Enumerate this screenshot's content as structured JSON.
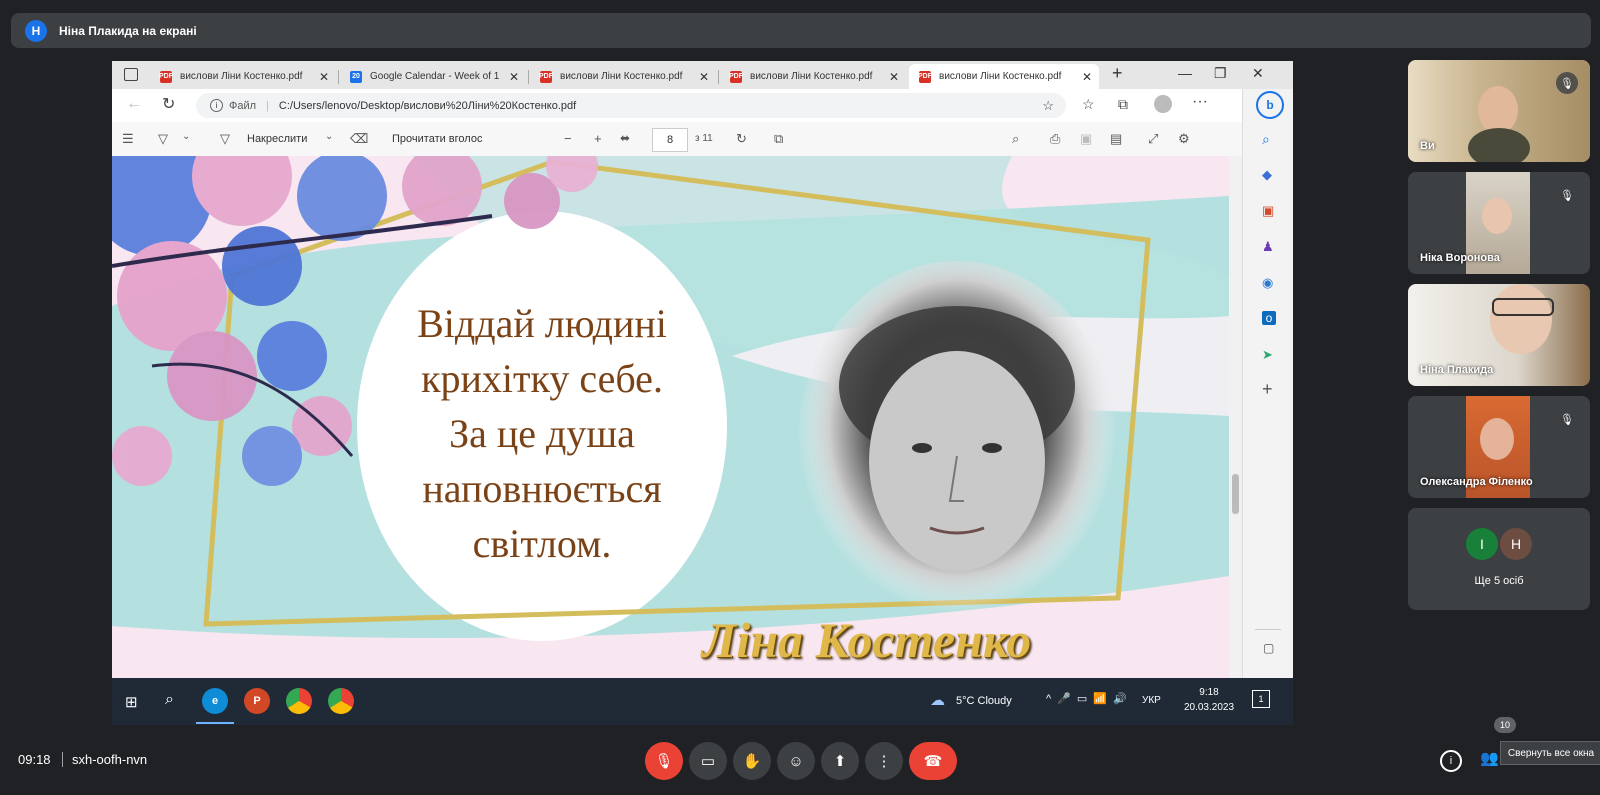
{
  "banner": {
    "initial": "Н",
    "text": "Ніна Плакида на екрані"
  },
  "browser": {
    "tabs": [
      {
        "label": "вислови Ліни Костенко.pdf",
        "icon": "pdf-icon"
      },
      {
        "label": "Google Calendar - Week of 1",
        "icon": "calendar-icon"
      },
      {
        "label": "вислови Ліни Костенко.pdf",
        "icon": "pdf-icon"
      },
      {
        "label": "вислови Ліни Костенко.pdf",
        "icon": "pdf-icon"
      },
      {
        "label": "вислови Ліни Костенко.pdf",
        "icon": "pdf-icon"
      }
    ],
    "file_label": "Файл",
    "url": "C:/Users/lenovo/Desktop/вислови%20Ліни%20Костенко.pdf"
  },
  "pdf_toolbar": {
    "draw_label": "Накреслити",
    "read_aloud": "Прочитати вголос",
    "page": "8",
    "of_pages": "з 11"
  },
  "slide": {
    "quote_lines": [
      "Віддай людині",
      "крихітку себе.",
      "За це душа",
      "наповнюється",
      "світлом."
    ],
    "signature": "Ліна Костенко"
  },
  "taskbar": {
    "weather": "5°C  Cloudy",
    "lang": "УКР",
    "time": "9:18",
    "date": "20.03.2023",
    "notif": "1"
  },
  "participants": [
    {
      "name": "Ви",
      "muted": true
    },
    {
      "name": "Ніка Воронова",
      "muted": true
    },
    {
      "name": "Ніна Плакида",
      "muted": false
    },
    {
      "name": "Олександра Філенко",
      "muted": true
    }
  ],
  "more": {
    "avatars": [
      "І",
      "Н"
    ],
    "label": "Ще 5 осіб"
  },
  "meeting": {
    "time": "09:18",
    "code": "sxh-oofh-nvn",
    "people_count": "10",
    "tooltip": "Свернуть все окна"
  },
  "colors": {
    "end_call": "#ea4335",
    "mic_off": "#ea4335",
    "accent": "#1a73e8",
    "quote_text": "#7a4217",
    "signature": "#e0b84a"
  }
}
